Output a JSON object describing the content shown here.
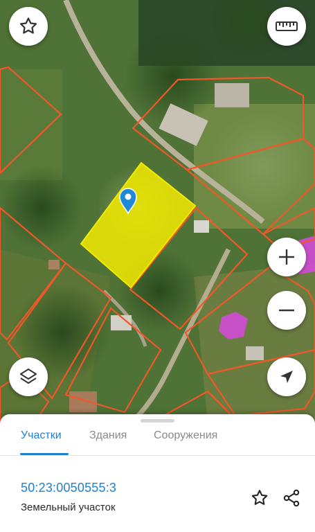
{
  "map": {
    "icons": {
      "favorite": "star-outline-icon",
      "ruler": "ruler-icon",
      "zoom_in": "plus-icon",
      "zoom_out": "minus-icon",
      "layers": "layers-icon",
      "location": "navigation-arrow-icon",
      "pin": "map-pin-icon"
    },
    "colors": {
      "boundary": "#f0582a",
      "selected_fill": "#f2ea00",
      "building_fill": "#d24bd6",
      "pin": "#1e8ad6"
    }
  },
  "sheet": {
    "tabs": [
      {
        "label": "Участки",
        "active": true
      },
      {
        "label": "Здания",
        "active": false
      },
      {
        "label": "Сооружения",
        "active": false
      }
    ],
    "parcel": {
      "cadastral_number": "50:23:0050555:3",
      "type": "Земельный участок"
    },
    "icons": {
      "favorite": "star-outline-icon",
      "share": "share-icon"
    },
    "accent_color": "#1f7fd0"
  }
}
